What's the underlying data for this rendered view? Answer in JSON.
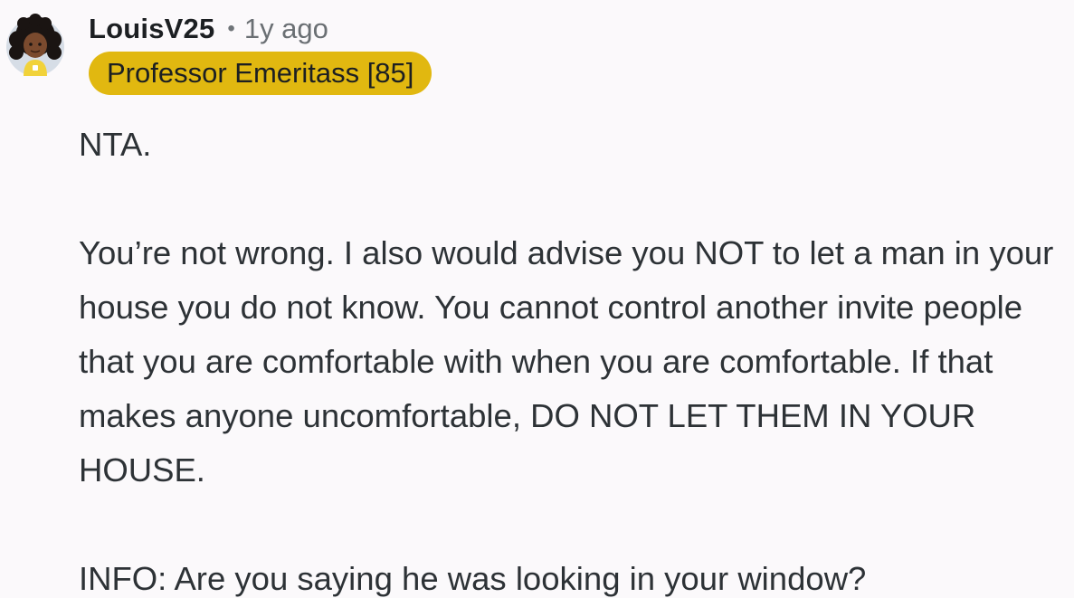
{
  "comment": {
    "author": "LouisV25",
    "separator": "•",
    "timestamp": "1y ago",
    "flair": "Professor Emeritass [85]",
    "paragraphs": [
      "NTA.",
      "You’re not wrong. I also would advise you NOT to let a man in your house you do not know. You cannot control another invite people that you are comfortable with when you are comfortable. If that makes anyone uncomfortable, DO NOT LET THEM IN YOUR HOUSE.",
      "INFO: Are you saying he was looking in your window?"
    ]
  },
  "colors": {
    "background": "#fbf9fb",
    "flair_background": "#e1b810",
    "text": "#2d3236",
    "meta_text": "#6a6f73"
  },
  "icons": {
    "avatar": "user-avatar-icon"
  }
}
